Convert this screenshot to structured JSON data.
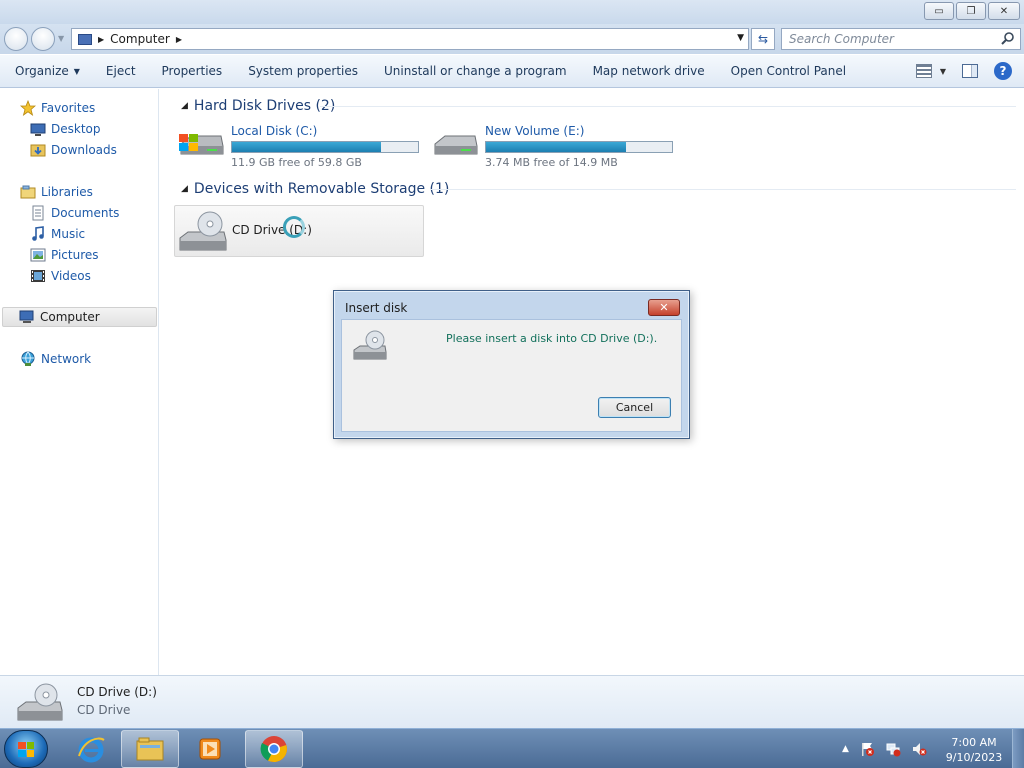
{
  "window": {
    "minimize": "▭",
    "maximize": "❐",
    "close": "✕"
  },
  "address": {
    "location": "Computer",
    "search_placeholder": "Search Computer"
  },
  "toolbar": {
    "organize": "Organize",
    "eject": "Eject",
    "properties": "Properties",
    "system_properties": "System properties",
    "uninstall": "Uninstall or change a program",
    "map_drive": "Map network drive",
    "control_panel": "Open Control Panel",
    "help": "?"
  },
  "sidebar": {
    "favorites": "Favorites",
    "desktop": "Desktop",
    "downloads": "Downloads",
    "libraries": "Libraries",
    "documents": "Documents",
    "music": "Music",
    "pictures": "Pictures",
    "videos": "Videos",
    "computer": "Computer",
    "network": "Network"
  },
  "groups": {
    "hdd_header": "Hard Disk Drives (2)",
    "removable_header": "Devices with Removable Storage (1)"
  },
  "drives": [
    {
      "name": "Local Disk (C:)",
      "free": "11.9 GB free of 59.8 GB",
      "used_fraction": 0.8
    },
    {
      "name": "New Volume (E:)",
      "free": "3.74 MB free of 14.9 MB",
      "used_fraction": 0.75
    }
  ],
  "cd_drive": {
    "name": "CD Drive (D:)"
  },
  "dialog": {
    "title": "Insert disk",
    "close": "✕",
    "message": "Please insert a disk into CD Drive (D:).",
    "cancel": "Cancel"
  },
  "details": {
    "name": "CD Drive (D:)",
    "type": "CD Drive"
  },
  "taskbar": {
    "time": "7:00 AM",
    "date": "9/10/2023"
  }
}
